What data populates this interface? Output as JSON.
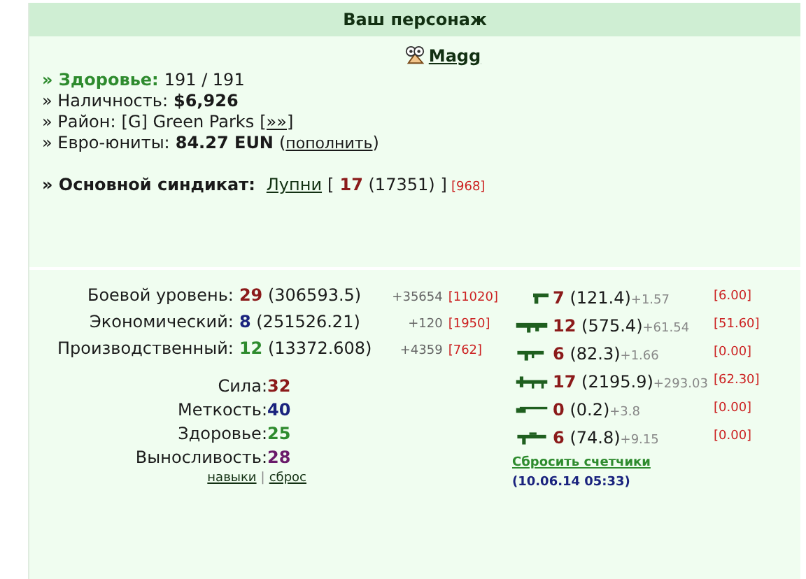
{
  "header": {
    "title": "Ваш персонаж"
  },
  "character": {
    "name": "Magg"
  },
  "info": [
    {
      "kind": "health",
      "label": "» Здоровье:",
      "value": "191 / 191"
    },
    {
      "kind": "cash",
      "label": "» Наличность:",
      "value": "$6,926"
    },
    {
      "kind": "district",
      "label": "» Район:",
      "value": "[G] Green Parks",
      "link": "[»»]"
    },
    {
      "kind": "euro",
      "label": "» Евро-юниты:",
      "value": "84.27 EUN",
      "link_open": "(",
      "link": "пополнить",
      "link_close": ")"
    }
  ],
  "syndicate": {
    "label": "» Основной синдикат:",
    "name": "Лупни",
    "open": "[",
    "level": "17",
    "points": "(17351)",
    "close": "]",
    "extra": "[968]"
  },
  "levels": [
    {
      "label": "Боевой уровень:",
      "value": "29",
      "exp": "(306593.5)",
      "gain": "+35654",
      "bonus": "[11020]",
      "color": "#8b1a1a"
    },
    {
      "label": "Экономический:",
      "value": "8",
      "exp": "(251526.21)",
      "gain": "+120",
      "bonus": "[1950]",
      "color": "#1a237e"
    },
    {
      "label": "Производственный:",
      "value": "12",
      "exp": "(13372.608)",
      "gain": "+4359",
      "bonus": "[762]",
      "color": "#2e8b2e"
    }
  ],
  "attributes": [
    {
      "label": "Сила:",
      "value": "32",
      "color": "#8b1a1a"
    },
    {
      "label": "Меткость:",
      "value": "40",
      "color": "#1a237e"
    },
    {
      "label": "Здоровье:",
      "value": "25",
      "color": "#2e8b2e"
    },
    {
      "label": "Выносливость:",
      "value": "28",
      "color": "#6a1b6a"
    }
  ],
  "attribute_links": [
    "навыки",
    "сброс"
  ],
  "attribute_links_separator": "|",
  "weapons": [
    {
      "kind": "pistol",
      "value": "7",
      "exp": "(121.4)",
      "gain": "+1.57",
      "bonus": "[6.00]"
    },
    {
      "kind": "launcher",
      "value": "12",
      "exp": "(575.4)",
      "gain": "+61.54",
      "bonus": "[51.60]"
    },
    {
      "kind": "smg",
      "value": "6",
      "exp": "(82.3)",
      "gain": "+1.66",
      "bonus": "[0.00]"
    },
    {
      "kind": "machinegun",
      "value": "17",
      "exp": "(2195.9)",
      "gain": "+293.03",
      "bonus": "[62.30]"
    },
    {
      "kind": "shotgun",
      "value": "0",
      "exp": "(0.2)",
      "gain": "+3.8",
      "bonus": "[0.00]"
    },
    {
      "kind": "rifle",
      "value": "6",
      "exp": "(74.8)",
      "gain": "+9.15",
      "bonus": "[0.00]"
    }
  ],
  "reset": {
    "link": "Сбросить счетчики",
    "date": "(10.06.14 05:33)"
  }
}
